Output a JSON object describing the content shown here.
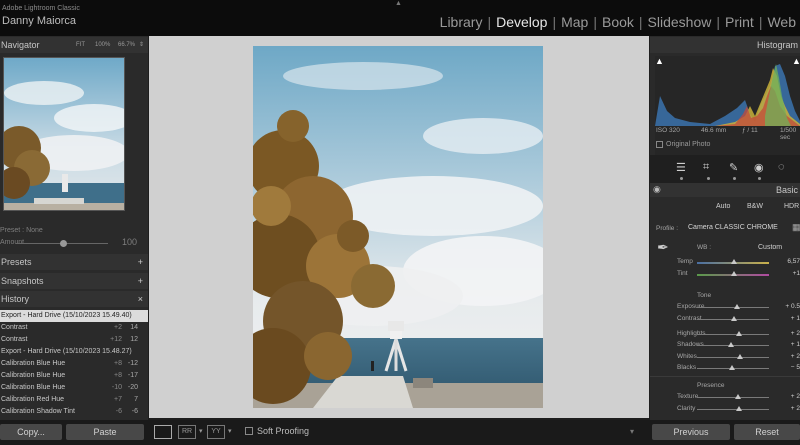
{
  "app": {
    "subtitle": "Adobe Lightroom Classic",
    "user": "Danny Maiorca"
  },
  "modules": [
    "Library",
    "Develop",
    "Map",
    "Book",
    "Slideshow",
    "Print",
    "Web"
  ],
  "active_module": "Develop",
  "navigator": {
    "title": "Navigator",
    "options": [
      "FIT",
      "100%",
      "66.7%"
    ]
  },
  "preset": {
    "label": "Preset : None",
    "amount_label": "Amount",
    "amount_value": "100"
  },
  "panels": {
    "presets": "Presets",
    "snapshots": "Snapshots",
    "history": "History"
  },
  "history": [
    {
      "label": "Export - Hard Drive (15/10/2023 15.49.40)",
      "a": "",
      "b": "",
      "selected": true
    },
    {
      "label": "Contrast",
      "a": "+2",
      "b": "14",
      "selected": false
    },
    {
      "label": "Contrast",
      "a": "+12",
      "b": "12",
      "selected": false
    },
    {
      "label": "Export - Hard Drive (15/10/2023 15.48.27)",
      "a": "",
      "b": "",
      "selected": false
    },
    {
      "label": "Calibration Blue Hue",
      "a": "+8",
      "b": "-12",
      "selected": false
    },
    {
      "label": "Calibration Blue Hue",
      "a": "+8",
      "b": "-17",
      "selected": false
    },
    {
      "label": "Calibration Blue Hue",
      "a": "-10",
      "b": "-20",
      "selected": false
    },
    {
      "label": "Calibration Red Hue",
      "a": "+7",
      "b": "7",
      "selected": false
    },
    {
      "label": "Calibration Shadow Tint",
      "a": "-6",
      "b": "-6",
      "selected": false
    }
  ],
  "buttons": {
    "copy": "Copy...",
    "paste": "Paste",
    "previous": "Previous",
    "reset": "Reset"
  },
  "toolbar": {
    "soft_proofing": "Soft Proofing"
  },
  "histogram": {
    "title": "Histogram",
    "iso": "ISO 320",
    "focal": "46.6 mm",
    "aperture": "ƒ / 11",
    "shutter": "1/500 sec",
    "original_photo": "Original Photo"
  },
  "basic": {
    "title": "Basic",
    "treatment": [
      "Auto",
      "B&W",
      "HDR"
    ],
    "profile_label": "Profile :",
    "profile_value": "Camera CLASSIC CHROME",
    "wb_label": "WB :",
    "wb_value": "Custom",
    "tone_label": "Tone",
    "presence_label": "Presence",
    "sliders": [
      {
        "name": "Temp",
        "value": "6,57",
        "level": 0.52,
        "group": "wb"
      },
      {
        "name": "Tint",
        "value": "+1",
        "level": 0.51,
        "group": "wb"
      },
      {
        "name": "Exposure",
        "value": "+ 0.5",
        "level": 0.55,
        "group": "tone"
      },
      {
        "name": "Contrast",
        "value": "+ 1",
        "level": 0.52,
        "group": "tone"
      },
      {
        "name": "Highlights",
        "value": "+ 2",
        "level": 0.58,
        "group": "tone"
      },
      {
        "name": "Shadows",
        "value": "+ 1",
        "level": 0.47,
        "group": "tone"
      },
      {
        "name": "Whites",
        "value": "+ 2",
        "level": 0.6,
        "group": "tone"
      },
      {
        "name": "Blacks",
        "value": "− 5",
        "level": 0.48,
        "group": "tone"
      },
      {
        "name": "Texture",
        "value": "+ 2",
        "level": 0.57,
        "group": "presence"
      },
      {
        "name": "Clarity",
        "value": "+ 2",
        "level": 0.59,
        "group": "presence"
      }
    ]
  },
  "colors": {
    "accent": "#e6e6e6",
    "panel": "#2a2a2a",
    "topbar": "#0c0c0c",
    "center_bg": "#d0d0d0"
  }
}
